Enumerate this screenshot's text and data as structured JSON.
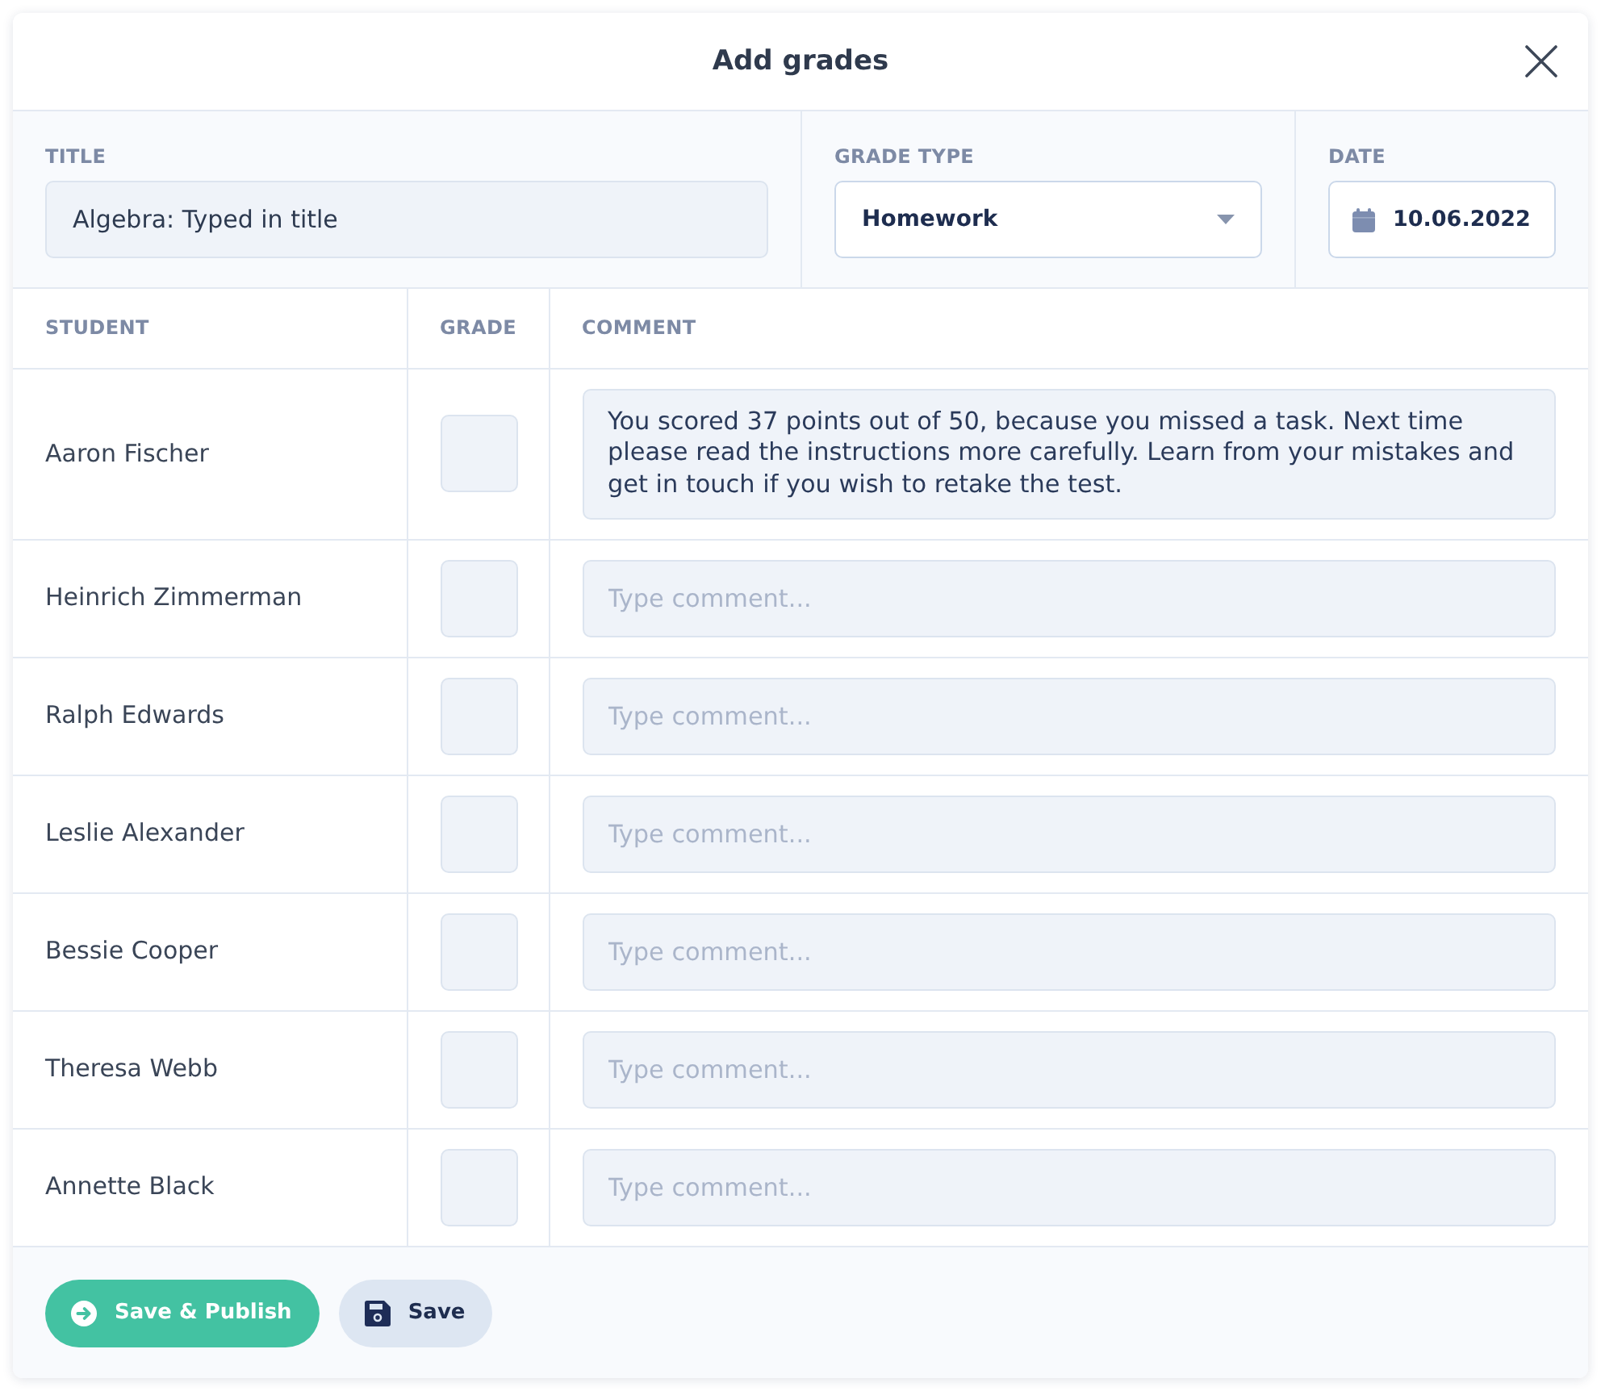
{
  "dialog": {
    "title": "Add grades"
  },
  "fields": [
    {
      "kind": "text",
      "label": "TITLE",
      "value": "Algebra: Typed in title"
    },
    {
      "kind": "select",
      "label": "GRADE TYPE",
      "value": "Homework"
    },
    {
      "kind": "date",
      "label": "DATE",
      "value": "10.06.2022"
    }
  ],
  "table": {
    "columns": [
      "STUDENT",
      "GRADE",
      "COMMENT"
    ],
    "rows": [
      {
        "student": "Aaron Fischer",
        "comment": {
          "value": "You scored 37 points out of 50, because you missed a task. Next time please read the instructions more carefully. Learn from your mistakes and get in touch if you wish to retake the test."
        }
      },
      {
        "student": "Heinrich Zimmerman",
        "comment": {
          "placeholder": "Type comment..."
        }
      },
      {
        "student": "Ralph Edwards",
        "comment": {
          "placeholder": "Type comment..."
        }
      },
      {
        "student": "Leslie Alexander",
        "comment": {
          "placeholder": "Type comment..."
        }
      },
      {
        "student": "Bessie Cooper",
        "comment": {
          "placeholder": "Type comment..."
        }
      },
      {
        "student": "Theresa Webb",
        "comment": {
          "placeholder": "Type comment..."
        }
      },
      {
        "student": "Annette Black",
        "comment": {
          "placeholder": "Type comment..."
        }
      }
    ]
  },
  "buttons": [
    {
      "kind": "primary",
      "label": "Save & Publish"
    },
    {
      "kind": "secondary",
      "label": "Save"
    }
  ]
}
